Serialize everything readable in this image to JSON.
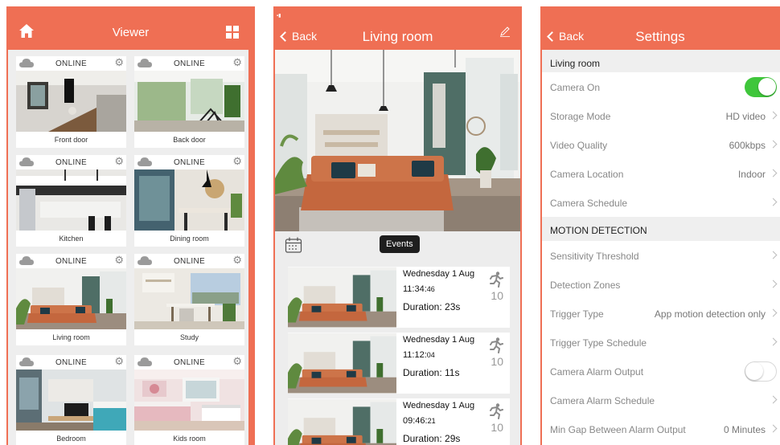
{
  "viewer": {
    "title": "Viewer",
    "icons": {
      "home": "home-icon",
      "grid": "grid-icon",
      "cloud": "cloud-icon",
      "gear": "gear-icon"
    },
    "cameras": [
      {
        "status": "ONLINE",
        "label": "Front door"
      },
      {
        "status": "ONLINE",
        "label": "Back door"
      },
      {
        "status": "ONLINE",
        "label": "Kitchen"
      },
      {
        "status": "ONLINE",
        "label": "Dining room"
      },
      {
        "status": "ONLINE",
        "label": "Living room"
      },
      {
        "status": "ONLINE",
        "label": "Study"
      },
      {
        "status": "ONLINE",
        "label": "Bedroom"
      },
      {
        "status": "ONLINE",
        "label": "Kids room"
      }
    ]
  },
  "room": {
    "back_label": "Back",
    "title": "Living room",
    "events_label": "Events",
    "events": [
      {
        "date": "Wednesday 1 Aug",
        "time_main": "11:34:",
        "time_sec": "46",
        "duration": "Duration: 23s",
        "count": "10"
      },
      {
        "date": "Wednesday 1 Aug",
        "time_main": "11:12:",
        "time_sec": "04",
        "duration": "Duration: 11s",
        "count": "10"
      },
      {
        "date": "Wednesday 1 Aug",
        "time_main": "09:46:",
        "time_sec": "21",
        "duration": "Duration: 29s",
        "count": "10"
      }
    ]
  },
  "settings": {
    "back_label": "Back",
    "title": "Settings",
    "section1": "Living room",
    "camera_on": {
      "label": "Camera On",
      "on": true
    },
    "storage_mode": {
      "label": "Storage Mode",
      "value": "HD video"
    },
    "video_quality": {
      "label": "Video Quality",
      "value": "600kbps"
    },
    "camera_location": {
      "label": "Camera Location",
      "value": "Indoor"
    },
    "camera_schedule": {
      "label": "Camera Schedule"
    },
    "section2": "MOTION DETECTION",
    "sensitivity": {
      "label": "Sensitivity Threshold"
    },
    "zones": {
      "label": "Detection Zones"
    },
    "trigger_type": {
      "label": "Trigger Type",
      "value": "App motion detection only"
    },
    "trigger_schedule": {
      "label": "Trigger Type Schedule"
    },
    "alarm_output": {
      "label": "Camera Alarm Output",
      "on": false
    },
    "alarm_schedule": {
      "label": "Camera Alarm Schedule"
    },
    "min_gap": {
      "label": "Min Gap Between Alarm Output",
      "value": "0 Minutes"
    }
  },
  "colors": {
    "accent": "#ef6f54",
    "toggle_on": "#3fc63b"
  }
}
